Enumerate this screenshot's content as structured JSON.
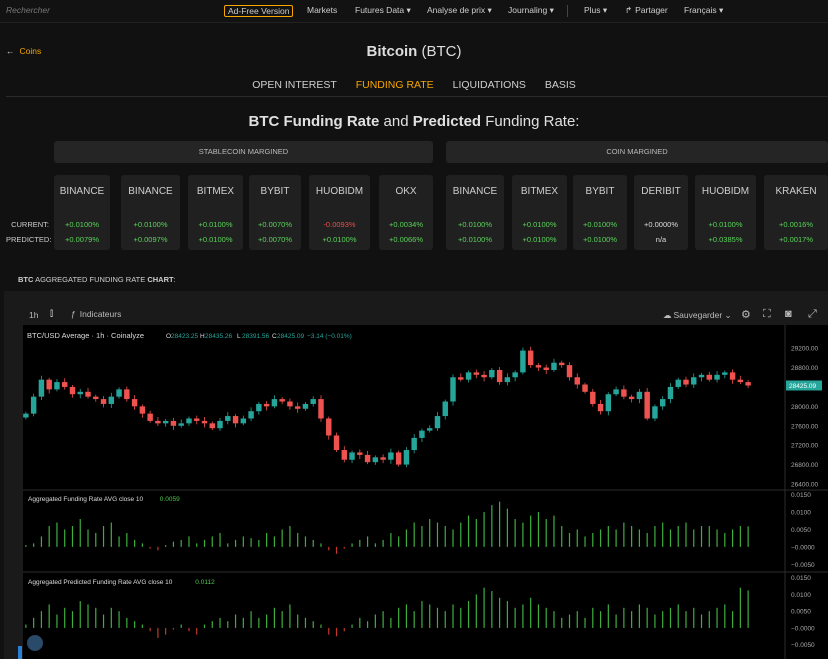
{
  "nav": {
    "search_placeholder": "Rechercher",
    "adfree": "Ad-Free Version",
    "markets": "Markets",
    "futures": "Futures Data ▾",
    "analyse": "Analyse de prix ▾",
    "journaling": "Journaling ▾",
    "plus": "Plus ▾",
    "partager": "Partager",
    "langue": "Français ▾"
  },
  "back": "Coins",
  "title": {
    "name": "Bitcoin",
    "symbol": "(BTC)"
  },
  "tabs": [
    "OPEN INTEREST",
    "FUNDING RATE",
    "LIQUIDATIONS",
    "BASIS"
  ],
  "active_tab": 1,
  "heading": {
    "p1": "BTC Funding Rate",
    "p2": " and ",
    "p3": "Predicted",
    "p4": " Funding Rate:"
  },
  "groups": {
    "stable": "STABLECOIN MARGINED",
    "coin": "COIN MARGINED"
  },
  "row_labels": {
    "current": "CURRENT:",
    "predicted": "PREDICTED:"
  },
  "stable": [
    {
      "name": "BINANCE",
      "current": "+0.0100%",
      "predicted": "+0.0079%",
      "cur_tone": "pos",
      "pre_tone": "pos"
    },
    {
      "name": "BINANCE",
      "current": "+0.0100%",
      "predicted": "+0.0097%",
      "cur_tone": "pos",
      "pre_tone": "pos"
    },
    {
      "name": "BITMEX",
      "current": "+0.0100%",
      "predicted": "+0.0100%",
      "cur_tone": "pos",
      "pre_tone": "pos"
    },
    {
      "name": "BYBIT",
      "current": "+0.0070%",
      "predicted": "+0.0070%",
      "cur_tone": "pos",
      "pre_tone": "pos"
    },
    {
      "name": "HUOBIDM",
      "current": "-0.0093%",
      "predicted": "+0.0100%",
      "cur_tone": "neg",
      "pre_tone": "pos"
    },
    {
      "name": "OKX",
      "current": "+0.0034%",
      "predicted": "+0.0066%",
      "cur_tone": "pos",
      "pre_tone": "pos"
    }
  ],
  "coin": [
    {
      "name": "BINANCE",
      "current": "+0.0100%",
      "predicted": "+0.0100%",
      "cur_tone": "pos",
      "pre_tone": "pos"
    },
    {
      "name": "BITMEX",
      "current": "+0.0100%",
      "predicted": "+0.0100%",
      "cur_tone": "pos",
      "pre_tone": "pos"
    },
    {
      "name": "BYBIT",
      "current": "+0.0100%",
      "predicted": "+0.0100%",
      "cur_tone": "pos",
      "pre_tone": "pos"
    },
    {
      "name": "DERIBIT",
      "current": "+0.0000%",
      "predicted": "n/a",
      "cur_tone": "neu",
      "pre_tone": "neu"
    },
    {
      "name": "HUOBIDM",
      "current": "+0.0100%",
      "predicted": "+0.0385%",
      "cur_tone": "pos",
      "pre_tone": "pos"
    },
    {
      "name": "KRAKEN",
      "current": "+0.0016%",
      "predicted": "+0.0017%",
      "cur_tone": "pos",
      "pre_tone": "pos"
    }
  ],
  "aggregated": {
    "b1": "BTC",
    "mid": " AGGREGATED FUNDING RATE ",
    "b2": "CHART",
    "end": ":"
  },
  "toolbar": {
    "interval": "1h",
    "indicators": "Indicateurs",
    "save": "Sauvegarder"
  },
  "colors": {
    "accent": "#f7a600",
    "up": "#26a69a",
    "down": "#ef5350",
    "bar": "#3fae3f",
    "bar_neg": "#c0392b"
  },
  "chart_data": [
    {
      "type": "candlestick",
      "title": "BTC/USD Average · 1h · Coinalyze",
      "ohlc_labels": [
        "O",
        "H",
        "L",
        "C"
      ],
      "ohlc": [
        "28423.25",
        "28435.26",
        "28391.56",
        "28425.09"
      ],
      "change": "−3.14 (−0.01%)",
      "price_label": "28425.09",
      "yticks": [
        "29200.00",
        "28800.00",
        "28400.00",
        "28000.00",
        "27600.00",
        "27200.00",
        "26800.00",
        "26400.00"
      ],
      "ylim": [
        26400,
        29450
      ],
      "closes": [
        27850,
        28200,
        28550,
        28350,
        28500,
        28400,
        28250,
        28300,
        28200,
        28150,
        28050,
        28200,
        28350,
        28150,
        28000,
        27850,
        27700,
        27650,
        27700,
        27600,
        27650,
        27750,
        27700,
        27650,
        27550,
        27700,
        27800,
        27650,
        27750,
        27900,
        28050,
        28000,
        28150,
        28100,
        28000,
        27950,
        28050,
        28150,
        27750,
        27400,
        27100,
        26900,
        27050,
        27000,
        26850,
        26950,
        26900,
        27050,
        26800,
        27100,
        27350,
        27500,
        27550,
        27800,
        28100,
        28600,
        28550,
        28700,
        28650,
        28600,
        28750,
        28500,
        28600,
        28700,
        29150,
        28850,
        28800,
        28750,
        28900,
        28850,
        28600,
        28450,
        28300,
        28050,
        27900,
        28250,
        28350,
        28200,
        28150,
        28300,
        27750,
        28000,
        28150,
        28400,
        28550,
        28450,
        28600,
        28650,
        28550,
        28650,
        28700,
        28550,
        28500,
        28430
      ]
    },
    {
      "type": "bar",
      "title": "Aggregated Funding Rate AVG close 10",
      "value_label": "0.0059",
      "yticks": [
        "0.0150",
        "0.0100",
        "0.0050",
        "−0.0000",
        "−0.0050"
      ],
      "ylim": [
        -0.0055,
        0.0152
      ],
      "values": [
        0.0005,
        0.001,
        0.003,
        0.006,
        0.007,
        0.005,
        0.006,
        0.008,
        0.005,
        0.004,
        0.006,
        0.007,
        0.003,
        0.004,
        0.002,
        0.001,
        -0.0005,
        -0.001,
        0.0005,
        0.0015,
        0.002,
        0.003,
        0.001,
        0.002,
        0.003,
        0.004,
        0.001,
        0.002,
        0.003,
        0.0025,
        0.002,
        0.004,
        0.003,
        0.005,
        0.006,
        0.004,
        0.003,
        0.002,
        0.001,
        -0.001,
        -0.002,
        -0.0005,
        0.001,
        0.002,
        0.003,
        0.001,
        0.002,
        0.004,
        0.003,
        0.005,
        0.007,
        0.006,
        0.008,
        0.007,
        0.006,
        0.005,
        0.007,
        0.009,
        0.008,
        0.01,
        0.012,
        0.013,
        0.011,
        0.008,
        0.007,
        0.009,
        0.01,
        0.008,
        0.009,
        0.006,
        0.004,
        0.005,
        0.003,
        0.004,
        0.005,
        0.006,
        0.005,
        0.007,
        0.006,
        0.005,
        0.004,
        0.006,
        0.007,
        0.005,
        0.006,
        0.007,
        0.005,
        0.006,
        0.006,
        0.005,
        0.004,
        0.005,
        0.006,
        0.0059
      ]
    },
    {
      "type": "bar",
      "title": "Aggregated Predicted Funding Rate AVG close 10",
      "value_label": "0.0112",
      "yticks": [
        "0.0150",
        "0.0100",
        "0.0050",
        "−0.0000",
        "−0.0050"
      ],
      "ylim": [
        -0.006,
        0.0155
      ],
      "values": [
        0.001,
        0.003,
        0.005,
        0.007,
        0.004,
        0.006,
        0.005,
        0.008,
        0.007,
        0.006,
        0.004,
        0.006,
        0.005,
        0.003,
        0.002,
        0.001,
        -0.001,
        -0.003,
        -0.002,
        -0.0005,
        0.001,
        -0.001,
        -0.002,
        0.001,
        0.002,
        0.003,
        0.002,
        0.004,
        0.003,
        0.005,
        0.003,
        0.004,
        0.006,
        0.005,
        0.007,
        0.004,
        0.003,
        0.002,
        0.001,
        -0.002,
        -0.0025,
        -0.001,
        0.001,
        0.003,
        0.002,
        0.004,
        0.005,
        0.003,
        0.006,
        0.007,
        0.005,
        0.008,
        0.007,
        0.006,
        0.005,
        0.007,
        0.006,
        0.008,
        0.01,
        0.012,
        0.011,
        0.009,
        0.008,
        0.006,
        0.007,
        0.009,
        0.007,
        0.006,
        0.005,
        0.003,
        0.004,
        0.005,
        0.003,
        0.006,
        0.005,
        0.007,
        0.004,
        0.006,
        0.005,
        0.007,
        0.006,
        0.004,
        0.005,
        0.006,
        0.007,
        0.005,
        0.006,
        0.004,
        0.005,
        0.006,
        0.007,
        0.005,
        0.012,
        0.0112
      ]
    }
  ]
}
